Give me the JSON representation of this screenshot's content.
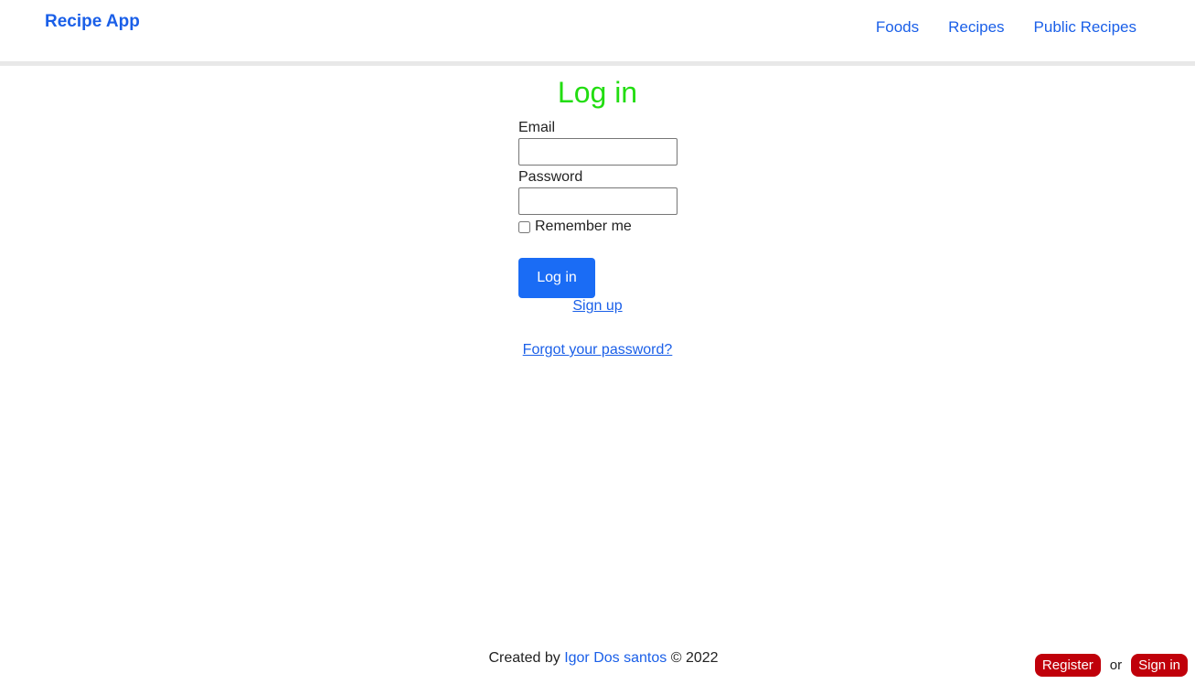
{
  "header": {
    "brand": "Recipe App",
    "nav": [
      "Foods",
      "Recipes",
      "Public Recipes"
    ]
  },
  "login": {
    "title": "Log in",
    "email_label": "Email",
    "email_value": "",
    "password_label": "Password",
    "password_value": "",
    "remember_label": "Remember me",
    "remember_checked": false,
    "submit_label": "Log in",
    "signup_link": "Sign up",
    "forgot_link": "Forgot your password?"
  },
  "footer": {
    "prefix": "Created by",
    "author": "Igor Dos santos",
    "suffix": "© 2022"
  },
  "auth_bar": {
    "register": "Register",
    "or": "or",
    "sign_in": "Sign in"
  },
  "colors": {
    "link_blue": "#1a5fe8",
    "title_green": "#22dd11",
    "button_blue": "#1a6cf5",
    "pill_red": "#c0000a"
  }
}
